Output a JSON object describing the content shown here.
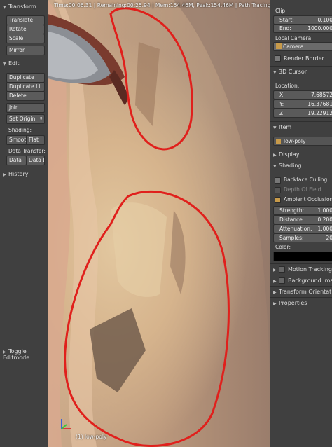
{
  "viewport": {
    "status": "Time:00:06.31 | Remaining:00:25.94 | Mem:154.46M, Peak:154.46M | Path Tracing Sample",
    "object_label": "(1) low-poly"
  },
  "toolshelf": {
    "transform_header": "Transform",
    "translate": "Translate",
    "rotate": "Rotate",
    "scale": "Scale",
    "mirror": "Mirror",
    "edit_header": "Edit",
    "duplicate": "Duplicate",
    "duplicate_linked": "Duplicate Li...",
    "delete": "Delete",
    "join": "Join",
    "set_origin": "Set Origin",
    "shading_label": "Shading:",
    "smooth": "Smoot",
    "flat": "Flat",
    "data_transfer_label": "Data Transfer:",
    "data": "Data",
    "data_layout": "Data L",
    "history_header": "History",
    "toggle_editmode": "Toggle Editmode"
  },
  "properties": {
    "clip_label": "Clip:",
    "clip_start_label": "Start:",
    "clip_start_value": "0.100",
    "clip_end_label": "End:",
    "clip_end_value": "1000.000",
    "local_camera_label": "Local Camera:",
    "camera_value": "Camera",
    "render_border": "Render Border",
    "cursor_header": "3D Cursor",
    "location_label": "Location:",
    "x_label": "X:",
    "x_value": "7.68572",
    "y_label": "Y:",
    "y_value": "16.37681",
    "z_label": "Z:",
    "z_value": "19.22912",
    "item_header": "Item",
    "item_name": "low-poly",
    "display_header": "Display",
    "shading_header": "Shading",
    "backface_culling": "Backface Culling",
    "depth_of_field": "Depth Of Field",
    "ambient_occlusion": "Ambient Occlusion",
    "strength_label": "Strength:",
    "strength_value": "1.000",
    "distance_label": "Distance:",
    "distance_value": "0.200",
    "attenuation_label": "Attenuation:",
    "attenuation_value": "1.000",
    "samples_label": "Samples:",
    "samples_value": "20",
    "color_label": "Color:",
    "motion_tracking": "Motion Tracking",
    "background_images": "Background Ima",
    "transform_orientations": "Transform Orientatio",
    "properties_header": "Properties"
  },
  "colors": {
    "annotation": "#e0201c",
    "panel_bg": "#404040",
    "accent": "#c79a4a"
  }
}
